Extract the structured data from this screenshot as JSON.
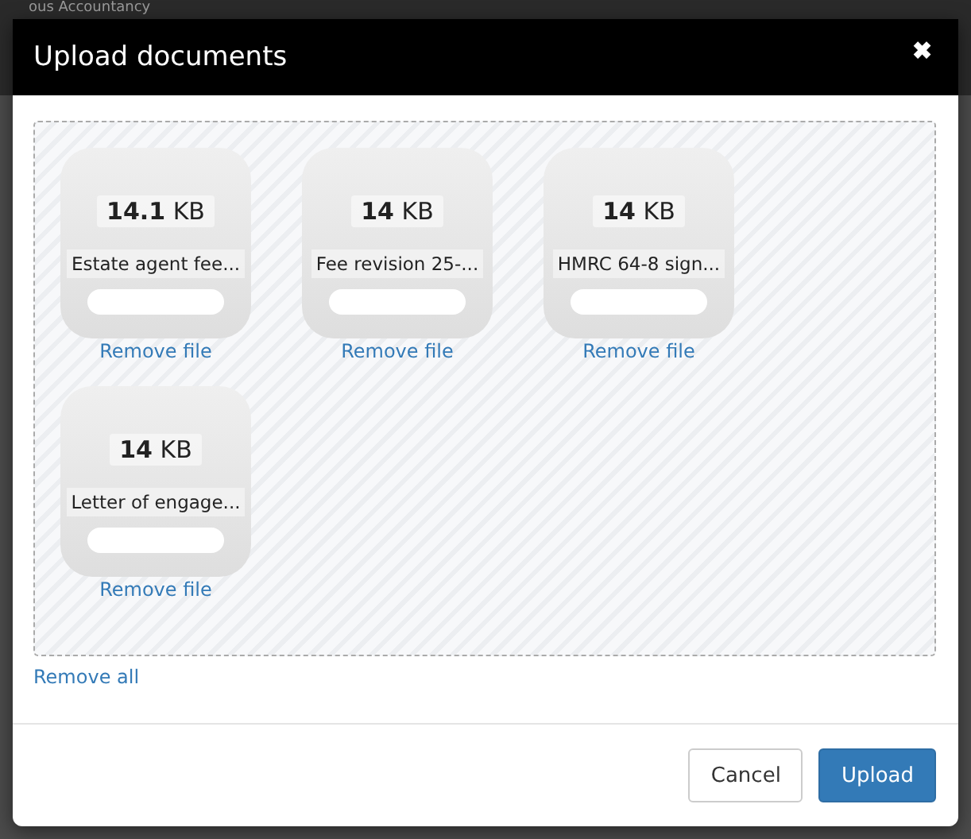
{
  "background": {
    "title": "ous Accountancy"
  },
  "dialog": {
    "title": "Upload documents",
    "close": "✖",
    "files": [
      {
        "size_value": "14.1",
        "size_unit": "KB",
        "name": "Estate agent fee...",
        "level": 0,
        "remove": "Remove file"
      },
      {
        "size_value": "14",
        "size_unit": "KB",
        "name": "Fee revision 25-...",
        "level": 0,
        "remove": "Remove file"
      },
      {
        "size_value": "14",
        "size_unit": "KB",
        "name": "HMRC 64-8 sign...",
        "level": 0,
        "remove": "Remove file"
      },
      {
        "size_value": "14",
        "size_unit": "KB",
        "name": "Letter of engage...",
        "level": 0,
        "remove": "Remove file"
      }
    ],
    "remove_all": "Remove all",
    "buttons": [
      {
        "label": "Cancel",
        "kind": "default"
      },
      {
        "label": "Upload",
        "kind": "primary"
      }
    ]
  }
}
